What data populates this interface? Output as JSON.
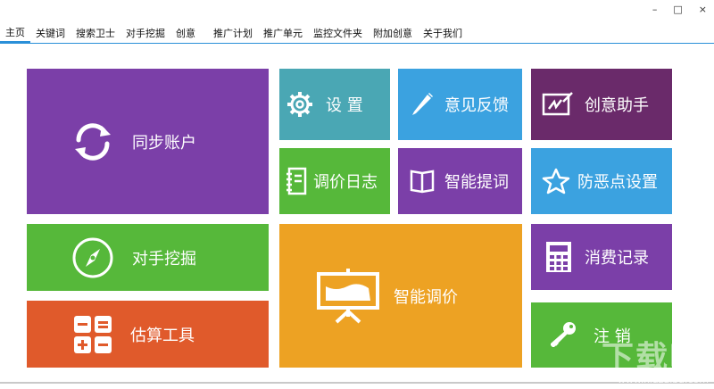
{
  "window": {
    "minimize_glyph": "–",
    "maximize_glyph": "□",
    "close_glyph": "×"
  },
  "menu": [
    {
      "label": "主页"
    },
    {
      "label": "关键词"
    },
    {
      "label": "搜索卫士"
    },
    {
      "label": "对手挖掘"
    },
    {
      "label": "创意"
    },
    {
      "label": "推广计划"
    },
    {
      "label": "推广单元"
    },
    {
      "label": "监控文件夹"
    },
    {
      "label": "附加创意"
    },
    {
      "label": "关于我们"
    }
  ],
  "tiles": {
    "sync": {
      "label": "同步账户",
      "color": "#7b3fa8",
      "icon": "sync-icon"
    },
    "settings": {
      "label": "设 置",
      "color": "#4aa7b4",
      "icon": "gear-icon"
    },
    "feedback": {
      "label": "意见反馈",
      "color": "#3ba2e0",
      "icon": "pencil-icon"
    },
    "creative": {
      "label": "创意助手",
      "color": "#6a2a6a",
      "icon": "sign-board-icon"
    },
    "pricelog": {
      "label": "调价日志",
      "color": "#56b83a",
      "icon": "notebook-icon"
    },
    "smartword": {
      "label": "智能提词",
      "color": "#7b3fa8",
      "icon": "book-icon"
    },
    "antimalicious": {
      "label": "防恶点设置",
      "color": "#3ba2e0",
      "icon": "star-icon"
    },
    "competitor": {
      "label": "对手挖掘",
      "color": "#56b83a",
      "icon": "compass-icon"
    },
    "smartbid": {
      "label": "智能调价",
      "color": "#eda223",
      "icon": "presentation-icon"
    },
    "spending": {
      "label": "消费记录",
      "color": "#7b3fa8",
      "icon": "calculator-icon"
    },
    "estimate": {
      "label": "估算工具",
      "color": "#e05a2b",
      "icon": "math-ops-icon"
    },
    "logout": {
      "label": "注 销",
      "color": "#56b83a",
      "icon": "key-icon"
    }
  },
  "watermark": {
    "big": "下载吧",
    "small": "www.xiazaiba.com"
  }
}
